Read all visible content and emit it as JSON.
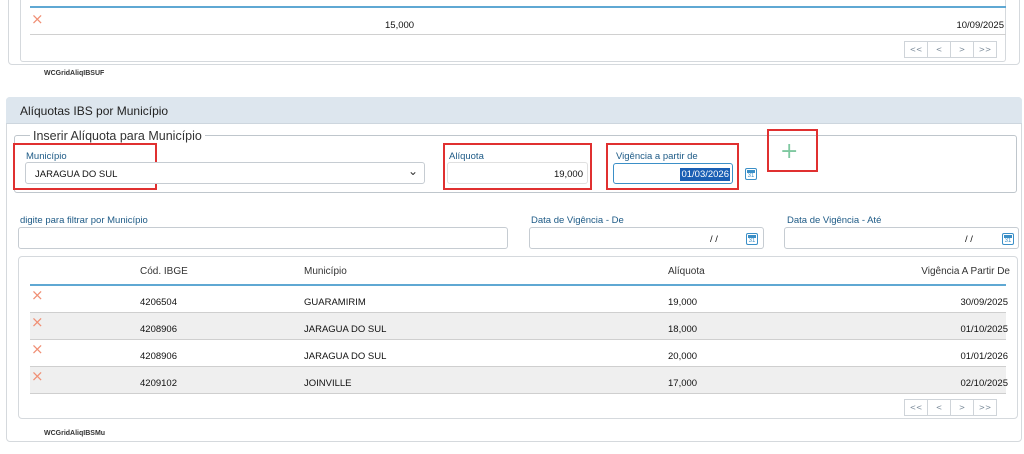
{
  "uf_grid": {
    "row": {
      "aliquota": "15,000",
      "vigencia": "10/09/2025"
    },
    "pager": [
      "<<",
      "<",
      ">",
      ">>"
    ],
    "name": "WCGridAliqIBSUF"
  },
  "section": {
    "title": "Alíquotas IBS por Município",
    "legend": "Inserir Alíquota para Município",
    "municipio_label": "Município",
    "municipio_value": "JARAGUA DO SUL",
    "aliquota_label": "Alíquota",
    "aliquota_value": "19,000",
    "vigencia_label": "Vigência a partir de",
    "vigencia_value": "01/03/2026",
    "add_icon": "+"
  },
  "filters": {
    "municipio_label": "digite para filtrar por Município",
    "de_label": "Data de Vigência - De",
    "de_value": "/ /",
    "ate_label": "Data de Vigência - Até",
    "ate_value": "/ /"
  },
  "grid": {
    "headers": [
      "Cód. IBGE",
      "Município",
      "Alíquota",
      "Vigência A Partir De"
    ],
    "rows": [
      {
        "cod": "4206504",
        "municipio": "GUARAMIRIM",
        "aliquota": "19,000",
        "vigencia": "30/09/2025"
      },
      {
        "cod": "4208906",
        "municipio": "JARAGUA DO SUL",
        "aliquota": "18,000",
        "vigencia": "01/10/2025"
      },
      {
        "cod": "4208906",
        "municipio": "JARAGUA DO SUL",
        "aliquota": "20,000",
        "vigencia": "01/01/2026"
      },
      {
        "cod": "4209102",
        "municipio": "JOINVILLE",
        "aliquota": "17,000",
        "vigencia": "02/10/2025"
      }
    ],
    "pager": [
      "<<",
      "<",
      ">",
      ">>"
    ],
    "name": "WCGridAliqIBSMu"
  },
  "icons": {
    "delete": "×",
    "calendar_day": "31",
    "dropdown": "⌄"
  },
  "colors": {
    "accent": "#5fa8d3",
    "highlight": "#e03030",
    "delete": "#f08f74",
    "add": "#7fc8a0"
  }
}
